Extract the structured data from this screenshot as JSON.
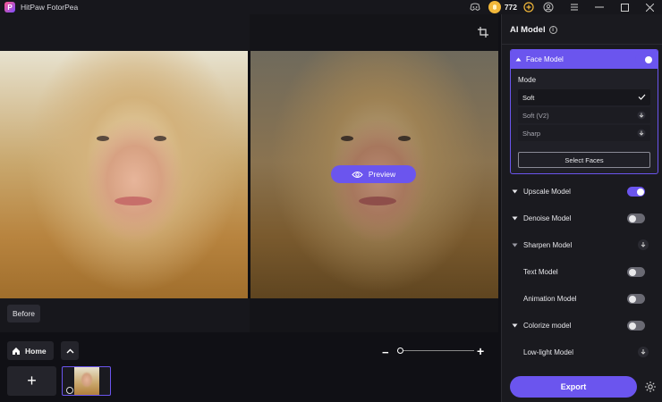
{
  "window": {
    "title": "HitPaw FotorPea",
    "credits": "772"
  },
  "canvas": {
    "preview_label": "Preview",
    "before_label": "Before"
  },
  "bottom": {
    "home_label": "Home",
    "add_label": "+",
    "zoom_minus": "−",
    "zoom_plus": "+",
    "zoom_level": 0
  },
  "panel": {
    "title": "AI Model",
    "face_model": {
      "label": "Face Model",
      "enabled": true,
      "mode_label": "Mode",
      "modes": [
        {
          "label": "Soft",
          "selected": true,
          "icon": "check-icon"
        },
        {
          "label": "Soft (V2)",
          "selected": false,
          "icon": "download-icon"
        },
        {
          "label": "Sharp",
          "selected": false,
          "icon": "download-icon"
        }
      ],
      "select_faces_label": "Select Faces"
    },
    "models": [
      {
        "label": "Upscale Model",
        "expandable": true,
        "state": "on"
      },
      {
        "label": "Denoise Model",
        "expandable": true,
        "state": "off"
      },
      {
        "label": "Sharpen Model",
        "expandable": true,
        "state": "download"
      },
      {
        "label": "Text Model",
        "expandable": false,
        "state": "off"
      },
      {
        "label": "Animation Model",
        "expandable": false,
        "state": "off"
      },
      {
        "label": "Colorize model",
        "expandable": true,
        "state": "off"
      },
      {
        "label": "Low-light Model",
        "expandable": false,
        "state": "download"
      }
    ],
    "export_label": "Export"
  },
  "colors": {
    "accent": "#6b55ee",
    "panel_bg": "#1a1a1f",
    "canvas_bg": "#17171c"
  }
}
